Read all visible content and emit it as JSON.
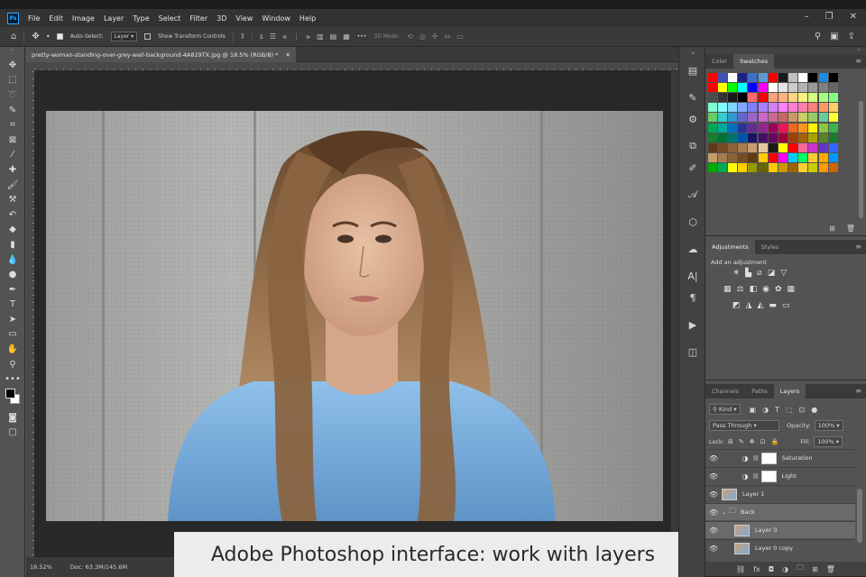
{
  "menu": [
    "File",
    "Edit",
    "Image",
    "Layer",
    "Type",
    "Select",
    "Filter",
    "3D",
    "View",
    "Window",
    "Help"
  ],
  "app_logo": "Ps",
  "options": {
    "auto_select_label": "Auto-Select:",
    "auto_select_target": "Layer",
    "transform_label": "Show Transform Controls",
    "three_d_mode": "3D Mode:",
    "more": "•••"
  },
  "document": {
    "tab_title": "pretty-woman-standing-over-grey-wall-background-4A829TX.jpg @ 18.5% (RGB/8) *",
    "zoom": "18.52%",
    "doc_size": "Doc: 63.3M/145.6M"
  },
  "caption": "Adobe Photoshop interface: work with layers",
  "panels": {
    "color_tab": "Color",
    "swatches_tab": "Swatches",
    "adjustments_tab": "Adjustments",
    "styles_tab": "Styles",
    "add_adjustment": "Add an adjustment",
    "channels_tab": "Channels",
    "paths_tab": "Paths",
    "layers_tab": "Layers"
  },
  "layers_controls": {
    "kind": "Kind",
    "blend_mode": "Pass Through",
    "opacity_label": "Opacity:",
    "opacity_value": "100%",
    "lock_label": "Lock:",
    "fill_label": "Fill:",
    "fill_value": "100%"
  },
  "layers": [
    {
      "name": "Saturation",
      "type": "adjustment"
    },
    {
      "name": "Light",
      "type": "adjustment"
    },
    {
      "name": "Layer 1",
      "type": "image"
    },
    {
      "name": "Back",
      "type": "group"
    },
    {
      "name": "Layer 0",
      "type": "image"
    },
    {
      "name": "Layer 0 copy",
      "type": "image"
    }
  ],
  "swatch_colors": [
    "#ff0000",
    "#3f51b5",
    "#ffffff",
    "#1a237e",
    "#3f6fc4",
    "#5b9bd5",
    "#ff0000",
    "#1a1a1a",
    "#c0c0c0",
    "#ffffff",
    "#000000",
    "#1e88e5",
    "#000000",
    "#ff0000",
    "#ffff00",
    "#00ff00",
    "#00ffff",
    "#0000ff",
    "#ff00ff",
    "#ffffff",
    "#e6e6e6",
    "#cccccc",
    "#b3b3b3",
    "#999999",
    "#808080",
    "#666666",
    "#4d4d4d",
    "#333333",
    "#1a1a1a",
    "#000000",
    "#ff6b6b",
    "#ff0000",
    "#ffa07a",
    "#ffb380",
    "#ffd480",
    "#fff080",
    "#d4ff80",
    "#a6ff80",
    "#80ff80",
    "#80ffd4",
    "#80ffff",
    "#80d4ff",
    "#80aaff",
    "#8080ff",
    "#aa80ff",
    "#d480ff",
    "#ff80ff",
    "#ff80d4",
    "#ff80aa",
    "#ff8080",
    "#ff9966",
    "#ffcc66",
    "#66cc66",
    "#33cccc",
    "#3399cc",
    "#6666cc",
    "#9966cc",
    "#cc66cc",
    "#cc6699",
    "#cc6666",
    "#cc9966",
    "#cccc66",
    "#99cc66",
    "#66cc99",
    "#ffff33",
    "#00a651",
    "#00a99d",
    "#0072bc",
    "#2e3192",
    "#662d91",
    "#92278f",
    "#9e005d",
    "#ed145b",
    "#f26522",
    "#f7941d",
    "#fff200",
    "#8dc63f",
    "#39b54a",
    "#197b30",
    "#007236",
    "#00746b",
    "#0054a6",
    "#1b1464",
    "#440e62",
    "#630460",
    "#9e0039",
    "#a0410d",
    "#a36209",
    "#aba000",
    "#598527",
    "#1a7b30",
    "#5e3a1d",
    "#754c24",
    "#8c6239",
    "#a67c52",
    "#c69c6d",
    "#e6c89c",
    "#1a1a1a",
    "#ffff00",
    "#ff0000",
    "#ff6699",
    "#cc33cc",
    "#6633cc",
    "#3366ff",
    "#c69c6d",
    "#a67c52",
    "#8c6239",
    "#754c24",
    "#603913",
    "#ffcc00",
    "#ff0000",
    "#ff00ff",
    "#00ccff",
    "#00ff66",
    "#ffcc33",
    "#ffaa00",
    "#0099ff",
    "#00aa00",
    "#00aa55",
    "#ffff00",
    "#ffcc00",
    "#999900",
    "#666600",
    "#ffcc00",
    "#cc9900",
    "#996600",
    "#ffcc33",
    "#cccc00",
    "#ff9900",
    "#cc6600"
  ]
}
